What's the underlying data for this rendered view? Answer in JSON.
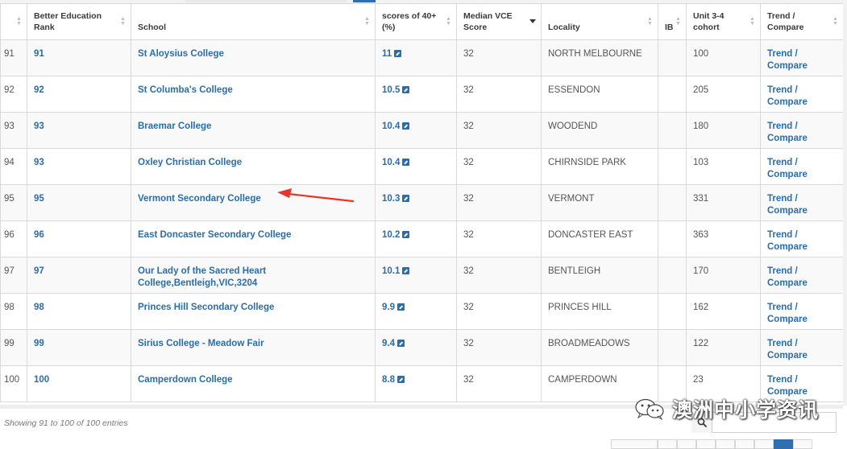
{
  "table": {
    "columns": [
      {
        "key": "rownum",
        "label": ""
      },
      {
        "key": "rank",
        "label": "Better Education Rank"
      },
      {
        "key": "school",
        "label": "School"
      },
      {
        "key": "score",
        "label": "scores of 40+ (%)"
      },
      {
        "key": "median",
        "label": "Median VCE Score"
      },
      {
        "key": "locality",
        "label": "Locality"
      },
      {
        "key": "ib",
        "label": "IB"
      },
      {
        "key": "cohort",
        "label": "Unit 3-4 cohort"
      },
      {
        "key": "trend",
        "label": "Trend / Compare"
      }
    ],
    "sorted_column": "Median VCE Score",
    "rows": [
      {
        "rownum": "91",
        "rank": "91",
        "school": "St Aloysius College",
        "score": "11",
        "median": "32",
        "locality": "NORTH MELBOURNE",
        "ib": "",
        "cohort": "100",
        "trend": "Trend / Compare"
      },
      {
        "rownum": "92",
        "rank": "92",
        "school": "St Columba's College",
        "score": "10.5",
        "median": "32",
        "locality": "ESSENDON",
        "ib": "",
        "cohort": "205",
        "trend": "Trend / Compare"
      },
      {
        "rownum": "93",
        "rank": "93",
        "school": "Braemar College",
        "score": "10.4",
        "median": "32",
        "locality": "WOODEND",
        "ib": "",
        "cohort": "180",
        "trend": "Trend / Compare"
      },
      {
        "rownum": "94",
        "rank": "93",
        "school": "Oxley Christian College",
        "score": "10.4",
        "median": "32",
        "locality": "CHIRNSIDE PARK",
        "ib": "",
        "cohort": "103",
        "trend": "Trend / Compare"
      },
      {
        "rownum": "95",
        "rank": "95",
        "school": "Vermont Secondary College",
        "score": "10.3",
        "median": "32",
        "locality": "VERMONT",
        "ib": "",
        "cohort": "331",
        "trend": "Trend / Compare"
      },
      {
        "rownum": "96",
        "rank": "96",
        "school": "East Doncaster Secondary College",
        "score": "10.2",
        "median": "32",
        "locality": "DONCASTER EAST",
        "ib": "",
        "cohort": "363",
        "trend": "Trend / Compare"
      },
      {
        "rownum": "97",
        "rank": "97",
        "school": "Our Lady of the Sacred Heart College,Bentleigh,VIC,3204",
        "score": "10.1",
        "median": "32",
        "locality": "BENTLEIGH",
        "ib": "",
        "cohort": "170",
        "trend": "Trend / Compare"
      },
      {
        "rownum": "98",
        "rank": "98",
        "school": "Princes Hill Secondary College",
        "score": "9.9",
        "median": "32",
        "locality": "PRINCES HILL",
        "ib": "",
        "cohort": "162",
        "trend": "Trend / Compare"
      },
      {
        "rownum": "99",
        "rank": "99",
        "school": "Sirius College - Meadow Fair",
        "score": "9.4",
        "median": "32",
        "locality": "BROADMEADOWS",
        "ib": "",
        "cohort": "122",
        "trend": "Trend / Compare"
      },
      {
        "rownum": "100",
        "rank": "100",
        "school": "Camperdown College",
        "score": "8.8",
        "median": "32",
        "locality": "CAMPERDOWN",
        "ib": "",
        "cohort": "23",
        "trend": "Trend / Compare"
      }
    ]
  },
  "highlighted_school": "Vermont Secondary College",
  "footer": {
    "info": "Showing 91 to 100 of 100 entries"
  },
  "search": {
    "value": ""
  },
  "watermark": {
    "text": "澳洲中小学资讯"
  },
  "colors": {
    "link": "#2a6da8",
    "arrow": "#e8352b",
    "active_page": "#2f6fb0"
  },
  "icons": {
    "score_link": "external-link-icon",
    "search": "search-icon",
    "watermark": "wechat-icon"
  }
}
